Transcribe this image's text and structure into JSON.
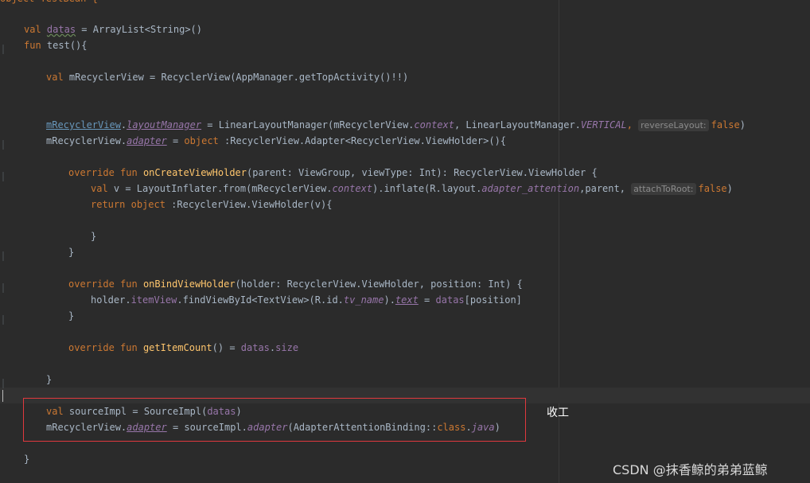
{
  "code": {
    "cut_top": "object TestBean {",
    "l1": {
      "kw": "val",
      "name": "datas",
      "rest": " = ArrayList<String>()"
    },
    "l2": {
      "kw": "fun",
      "name": "test",
      "rest": "(){"
    },
    "l3": {
      "kw": "val",
      "rest": " mRecyclerView = RecyclerView(AppManager.getTopActivity()!!)"
    },
    "l4": {
      "a": "mRecyclerView",
      ".": ".",
      "b": "layoutManager",
      "c": " = LinearLayoutManager(mRecyclerView.",
      "d": "context",
      "e": ", LinearLayoutManager.",
      "f": "VERTICAL",
      "g": ", ",
      "hint": "reverseLayout:",
      "h": "false",
      ")": ")"
    },
    "l5": {
      "a": "mRecyclerView.",
      "b": "adapter",
      "c": " = ",
      "kw": "object",
      "d": " :RecyclerView.Adapter<RecyclerView.ViewHolder>(){"
    },
    "l6": {
      "kw1": "override",
      "kw2": "fun",
      "fn": "onCreateViewHolder",
      "rest": "(parent: ViewGroup, viewType: Int): RecyclerView.ViewHolder {"
    },
    "l7": {
      "kw": "val",
      "a": " v = LayoutInflater.from(mRecyclerView.",
      "b": "context",
      "c": ").inflate(R.layout.",
      "d": "adapter_attention",
      "e": ",parent, ",
      "hint": "attachToRoot:",
      "f": "false",
      ")": ")"
    },
    "l8": {
      "kw1": "return",
      "kw2": "object",
      "rest": " :RecyclerView.ViewHolder(v){"
    },
    "l9": "}",
    "l10": "}",
    "l11": {
      "kw1": "override",
      "kw2": "fun",
      "fn": "onBindViewHolder",
      "rest": "(holder: RecyclerView.ViewHolder, position: Int) {"
    },
    "l12": {
      "a": "holder.",
      "b": "itemView",
      "c": ".findViewById<TextView>(R.id.",
      "d": "tv_name",
      "e": ").",
      "f": "text",
      "g": " = ",
      "h": "datas",
      "i": "[position]"
    },
    "l13": "}",
    "l14": {
      "kw1": "override",
      "kw2": "fun",
      "fn": "getItemCount",
      "a": "() = ",
      "b": "datas",
      "c": ".",
      "d": "size"
    },
    "l15": "}",
    "l16": {
      "kw": "val",
      "a": " sourceImpl = SourceImpl(",
      "b": "datas",
      ")": ")"
    },
    "l17": {
      "a": "mRecyclerView.",
      "b": "adapter",
      "c": " = sourceImpl.",
      "d": "adapter",
      "e": "(AdapterAttentionBinding::",
      "kw": "class",
      ".": ".",
      "f": "java",
      ")": ")"
    },
    "l18": "}"
  },
  "annotation": {
    "note": "收工"
  },
  "watermark": "CSDN @抹香鲸的弟弟蓝鲸"
}
